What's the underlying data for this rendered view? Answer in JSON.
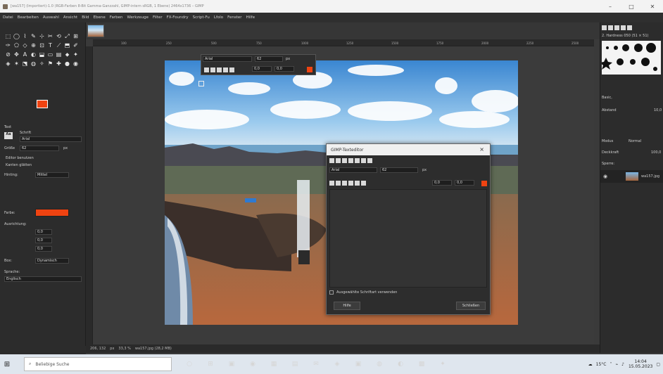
{
  "window": {
    "title": "[wa157] (Importiert)-1.0 (RGB-Farben 8-Bit Gamma-Ganzzahl, GIMP-intern sRGB, 1 Ebene) 2464x1736 – GIMP",
    "controls": [
      "–",
      "□",
      "✕"
    ]
  },
  "menu": {
    "items": [
      "Datei",
      "Bearbeiten",
      "Auswahl",
      "Ansicht",
      "Bild",
      "Ebene",
      "Farben",
      "Werkzeuge",
      "Filter",
      "FX-Foundry",
      "Script-Fu",
      "Lfolo",
      "Fenster",
      "Hilfe"
    ]
  },
  "toolbox": {
    "tools": [
      "⬚",
      "◯",
      "⌇",
      "✎",
      "⊹",
      "✂",
      "⟲",
      "⤢",
      "⊞",
      "✑",
      "⬠",
      "◇",
      "⊕",
      "⊡",
      "T",
      "⟋",
      "⬒",
      "✐",
      "⊘",
      "✥",
      "A",
      "◐",
      "⬓",
      "▭",
      "▤",
      "⬥",
      "✦",
      "◈",
      "✶",
      "⬔",
      "◍",
      "✧",
      "⚑",
      "✚",
      "●",
      "◉"
    ],
    "text_options_title": "Text",
    "font_label": "Schrift",
    "font_value": "Arial",
    "size_label": "Größe",
    "size_value": "62",
    "size_unit": "px",
    "option_1": "Editor benutzen",
    "option_2": "Kanten glätten",
    "hinting_label": "Hinting:",
    "hinting_value": "Mittel",
    "color_label": "Farbe:",
    "justify_label": "Ausrichtung:",
    "indent_values": [
      "0,0",
      "0,0",
      "0,0"
    ],
    "box_label": "Box:",
    "box_value": "Dynamisch",
    "language_label": "Sprache:",
    "language_value": "Englisch"
  },
  "ruler": {
    "labels": [
      "100",
      "250",
      "500",
      "750",
      "1000",
      "1250",
      "1500",
      "1750",
      "2000",
      "2250",
      "2500"
    ]
  },
  "text_toolbar": {
    "font": "Arial",
    "size": "62",
    "unit": "px",
    "val1": "0,0",
    "val2": "0,0"
  },
  "text_editor": {
    "title": "GIMP-Texteditor",
    "font": "Arial",
    "size": "62",
    "unit": "px",
    "val1": "0,0",
    "val2": "0,0",
    "checkbox_label": "Ausgewählte Schriftart verwenden",
    "help_button": "Hilfe",
    "close_button": "Schließen"
  },
  "statusbar": {
    "coords": "206, 132",
    "unit": "px",
    "zoom": "33,3 %",
    "file": "wa157.jpg (28,2 MB)"
  },
  "rightdock": {
    "brush_filter": "2. Hardness 050 (51 × 51)",
    "basic_label": "Basic,",
    "spacing_label": "Abstand",
    "spacing_value": "10,0",
    "mode_label": "Modus",
    "mode_value": "Normal",
    "opacity_label": "Deckkraft",
    "opacity_value": "100,0",
    "lock_label": "Sperre:",
    "layer_name": "wa157.jpg"
  },
  "taskbar": {
    "search_placeholder": "Beliebige Suche",
    "apps": [
      "○",
      "⊞",
      "▣",
      "◉",
      "▦",
      "▤",
      "✉",
      "◈",
      "▣",
      "◍",
      "◐",
      "▩",
      "✦"
    ],
    "weather": "15°C",
    "time": "14:04",
    "date": "15.05.2023"
  },
  "colors": {
    "foreground": "#ef4311",
    "background": "#ffffff"
  }
}
